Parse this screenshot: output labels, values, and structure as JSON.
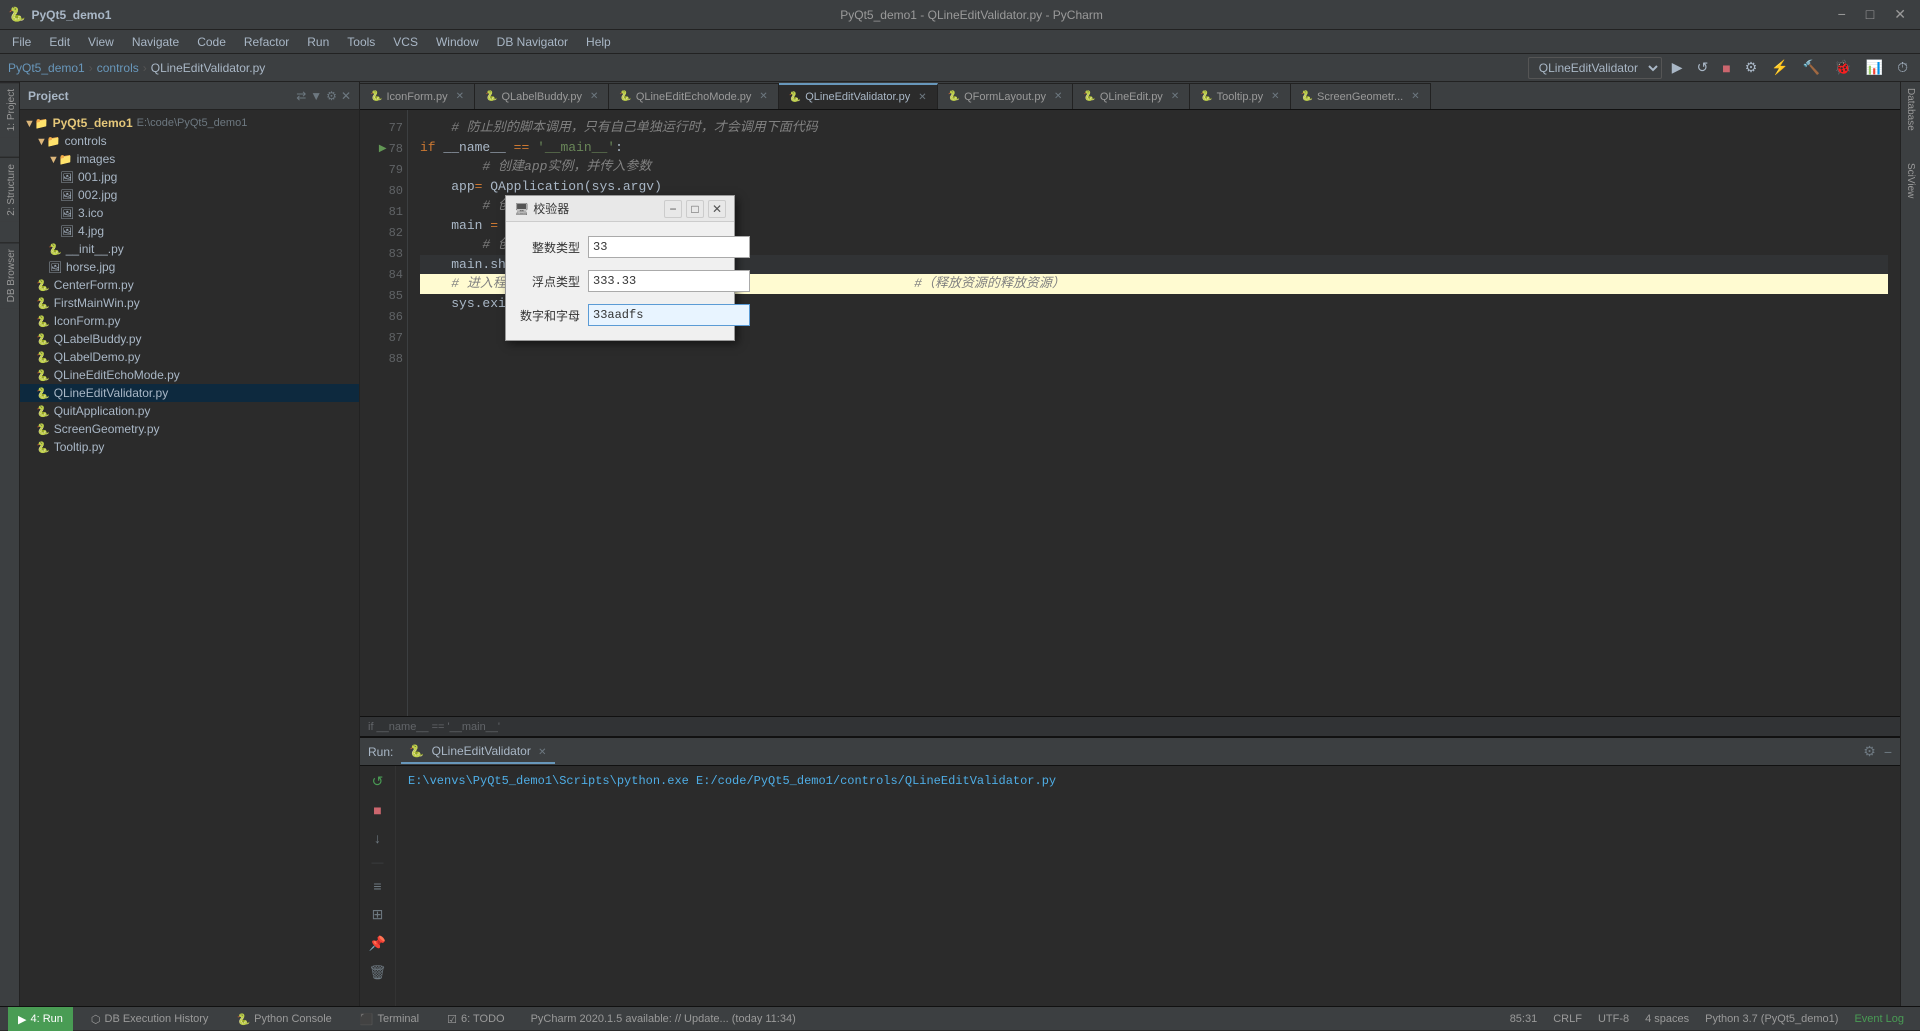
{
  "window": {
    "title": "PyQt5_demo1 - QLineEditValidator.py - PyCharm",
    "min": "−",
    "max": "□",
    "close": "✕"
  },
  "menu": {
    "items": [
      "File",
      "Edit",
      "View",
      "Navigate",
      "Code",
      "Refactor",
      "Run",
      "Tools",
      "VCS",
      "Window",
      "DB Navigator",
      "Help"
    ]
  },
  "breadcrumb": {
    "project": "PyQt5_demo1",
    "sep1": " › ",
    "folder": "controls",
    "sep2": " › ",
    "file": "QLineEditValidator.py"
  },
  "tabs": [
    {
      "label": "IconForm.py",
      "active": false
    },
    {
      "label": "QLabelBuddy.py",
      "active": false
    },
    {
      "label": "QLineEditEchoMode.py",
      "active": false
    },
    {
      "label": "QLineEditValidator.py",
      "active": true
    },
    {
      "label": "QFormLayout.py",
      "active": false
    },
    {
      "label": "QLineEdit.py",
      "active": false
    },
    {
      "label": "Tooltip.py",
      "active": false
    },
    {
      "label": "ScreenGeometr...",
      "active": false
    }
  ],
  "toolbar": {
    "validator_select": "QLineEditValidator",
    "run_label": "▶",
    "rerun_label": "↺",
    "config_label": "⚙"
  },
  "file_tree": {
    "root_label": "PyQt5_demo1",
    "root_path": "E:\\code\\PyQt5_demo1",
    "items": [
      {
        "indent": 1,
        "type": "folder",
        "label": "controls",
        "expanded": true
      },
      {
        "indent": 2,
        "type": "folder",
        "label": "images",
        "expanded": true
      },
      {
        "indent": 3,
        "type": "image",
        "label": "001.jpg"
      },
      {
        "indent": 3,
        "type": "image",
        "label": "002.jpg"
      },
      {
        "indent": 3,
        "type": "image",
        "label": "3.ico"
      },
      {
        "indent": 3,
        "type": "image",
        "label": "4.jpg"
      },
      {
        "indent": 2,
        "type": "py",
        "label": "__init__.py"
      },
      {
        "indent": 2,
        "type": "image",
        "label": "horse.jpg"
      },
      {
        "indent": 1,
        "type": "py",
        "label": "CenterForm.py"
      },
      {
        "indent": 1,
        "type": "py",
        "label": "FirstMainWin.py"
      },
      {
        "indent": 1,
        "type": "py",
        "label": "IconForm.py"
      },
      {
        "indent": 1,
        "type": "py",
        "label": "QLabelBuddy.py"
      },
      {
        "indent": 1,
        "type": "py",
        "label": "QLabelDemo.py"
      },
      {
        "indent": 1,
        "type": "py",
        "label": "QLineEditEchoMode.py"
      },
      {
        "indent": 1,
        "type": "py",
        "label": "QLineEditValidator.py",
        "selected": true
      },
      {
        "indent": 1,
        "type": "py",
        "label": "QuitApplication.py"
      },
      {
        "indent": 1,
        "type": "py",
        "label": "ScreenGeometry.py"
      },
      {
        "indent": 1,
        "type": "py",
        "label": "Tooltip.py"
      }
    ]
  },
  "code": {
    "lines": [
      {
        "num": "77",
        "text": "    # 防止别的脚本调用，只有自己单独运行时，才会调用下面代码",
        "type": "comment"
      },
      {
        "num": "78",
        "text": "if __name__ == '__main__':",
        "type": "code",
        "run_arrow": true
      },
      {
        "num": "79",
        "text": "        # 创建app实例，并传入参数",
        "type": "comment"
      },
      {
        "num": "80",
        "text": "    app= QApplication(sys.argv)",
        "type": "code"
      },
      {
        "num": "81",
        "text": "        # 创建对象",
        "type": "comment"
      },
      {
        "num": "82",
        "text": "    main = Q",
        "type": "code"
      },
      {
        "num": "83",
        "text": "        # 创建窗口",
        "type": "comment"
      },
      {
        "num": "84",
        "text": "    main.sho",
        "type": "code"
      },
      {
        "num": "85",
        "text": "    # 进入程序，进入事件循环                                       #（释放资源的释放资源）",
        "type": "comment"
      },
      {
        "num": "86",
        "text": "    sys.exit",
        "type": "code"
      },
      {
        "num": "87",
        "text": "",
        "type": "code"
      },
      {
        "num": "88",
        "text": "",
        "type": "code"
      }
    ],
    "bottom_text": "if __name__ == '__main__'"
  },
  "dialog": {
    "title": "校验器",
    "fields": [
      {
        "label": "整数类型",
        "value": "33",
        "error": false
      },
      {
        "label": "浮点类型",
        "value": "333.33",
        "error": false
      },
      {
        "label": "数字和字母",
        "value": "33aadfs",
        "error": true
      }
    ],
    "buttons": {
      "minimize": "−",
      "maximize": "□",
      "close": "✕"
    }
  },
  "run_panel": {
    "tab_label": "QLineEditValidator",
    "command": "E:\\venvs\\PyQt5_demo1\\Scripts\\python.exe E:/code/PyQt5_demo1/controls/QLineEditValidator.py"
  },
  "status_bar": {
    "update_msg": "PyCharm 2020.1.5 available: // Update... (today 11:34)",
    "position": "85:31",
    "crlf": "CRLF",
    "encoding": "UTF-8",
    "indent": "4 spaces",
    "python_version": "Python 3.7 (PyQt5_demo1)",
    "event_log": "Event Log"
  },
  "bottom_tabs": [
    {
      "icon": "▶",
      "label": "4: Run",
      "num": "4"
    },
    {
      "icon": "⬡",
      "label": "DB Execution History"
    },
    {
      "icon": "🐍",
      "label": "Python Console"
    },
    {
      "icon": "⬛",
      "label": "Terminal"
    },
    {
      "icon": "☑",
      "label": "6: TODO"
    }
  ],
  "vertical_labels": [
    "1: Project",
    "2: Structure",
    "DB Browser"
  ],
  "right_labels": [
    "Database"
  ],
  "icons": {
    "search": "🔍",
    "gear": "⚙",
    "run": "▶",
    "stop": "■",
    "rerun": "↺",
    "pin": "📌",
    "fold": "≡"
  }
}
